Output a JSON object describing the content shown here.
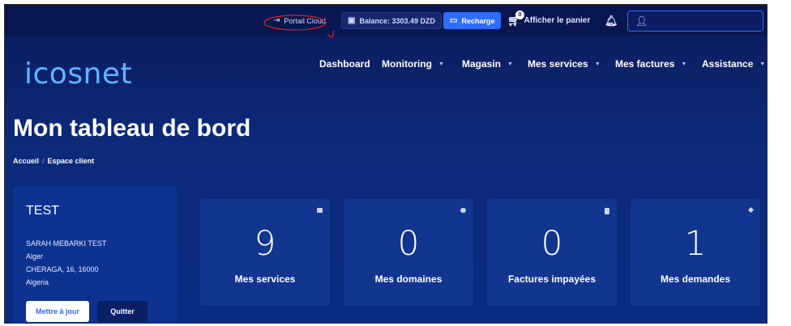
{
  "topbar": {
    "portail_label": "Portail Cloud",
    "balance_label": "Balance: 3303.49 DZD",
    "recharge_label": "Recharge",
    "cart_label": "Afficher le panier",
    "cart_count": "0"
  },
  "brand": {
    "logo_text": "icosnet"
  },
  "nav": {
    "items": [
      {
        "label": "Dashboard"
      },
      {
        "label": "Monitoring"
      },
      {
        "label": "Magasin"
      },
      {
        "label": "Mes services"
      },
      {
        "label": "Mes factures"
      },
      {
        "label": "Assistance"
      }
    ]
  },
  "page": {
    "title": "Mon tableau de bord",
    "breadcrumb": [
      "Accueil",
      "Espace client"
    ]
  },
  "profile": {
    "name": "TEST",
    "lines": [
      "SARAH MEBARKI TEST",
      "Alger",
      "CHERAGA, 16, 16000",
      "Algeria"
    ],
    "update_label": "Mettre à jour",
    "quit_label": "Quitter"
  },
  "stats": [
    {
      "value": "9",
      "label": "Mes services"
    },
    {
      "value": "0",
      "label": "Mes domaines"
    },
    {
      "value": "0",
      "label": "Factures impayées"
    },
    {
      "value": "1",
      "label": "Mes demandes"
    }
  ],
  "colors": {
    "accent": "#2f6bff",
    "logo": "#5fb5ff",
    "annotation": "#e02020"
  }
}
